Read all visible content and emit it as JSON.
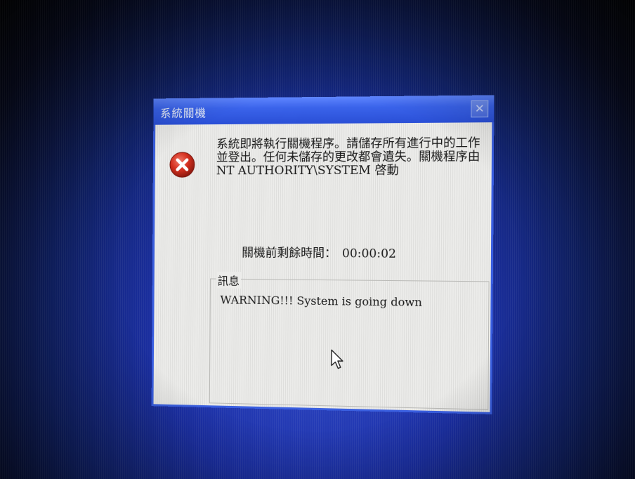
{
  "dialog": {
    "title": "系統關機",
    "close_label": "✕",
    "message": "系統即將執行關機程序。請儲存所有進行中的工作並登出。任何未儲存的更改都會遺失。關機程序由 NT AUTHORITY\\SYSTEM 啓動",
    "countdown_label": "關機前剩餘時間：",
    "countdown_value": "00:00:02",
    "info_group_label": "訊息",
    "info_message": "WARNING!!! System is going down",
    "icon": "error-icon"
  },
  "colors": {
    "desktop": "#1b2fa4",
    "titlebar": "#3a63ea",
    "dialog_body": "#ececea",
    "error_icon": "#d4301f"
  }
}
